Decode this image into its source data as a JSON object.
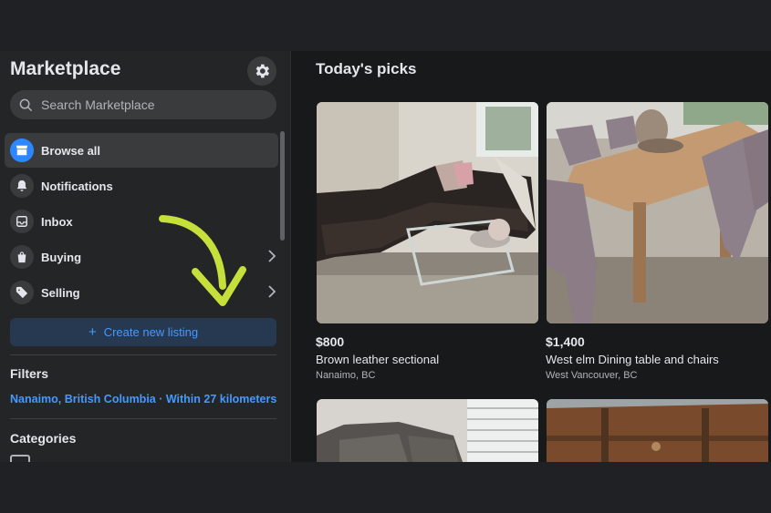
{
  "sidebar": {
    "title": "Marketplace",
    "search": {
      "placeholder": "Search Marketplace"
    },
    "nav": [
      {
        "label": "Browse all",
        "icon": "storefront-icon",
        "active": true
      },
      {
        "label": "Notifications",
        "icon": "bell-icon"
      },
      {
        "label": "Inbox",
        "icon": "inbox-icon"
      },
      {
        "label": "Buying",
        "icon": "shopping-bag-icon",
        "chevron": true
      },
      {
        "label": "Selling",
        "icon": "price-tag-icon",
        "chevron": true
      }
    ],
    "create_label": "Create new listing",
    "filters_heading": "Filters",
    "location_filter": "Nanaimo, British Columbia · Within 27 kilometers",
    "categories_heading": "Categories"
  },
  "main": {
    "heading": "Today's picks",
    "listings": [
      {
        "price": "$800",
        "title": "Brown leather sectional",
        "location": "Nanaimo, BC"
      },
      {
        "price": "$1,400",
        "title": "West elm Dining table and chairs",
        "location": "West Vancouver, BC"
      },
      {
        "price": "",
        "title": "",
        "location": ""
      },
      {
        "price": "",
        "title": "",
        "location": ""
      }
    ]
  },
  "colors": {
    "accent": "#2d88ff",
    "link": "#4599ff",
    "annotation_arrow": "#c6df3a",
    "sidebar_bg": "#242526",
    "page_bg": "#18191a"
  }
}
